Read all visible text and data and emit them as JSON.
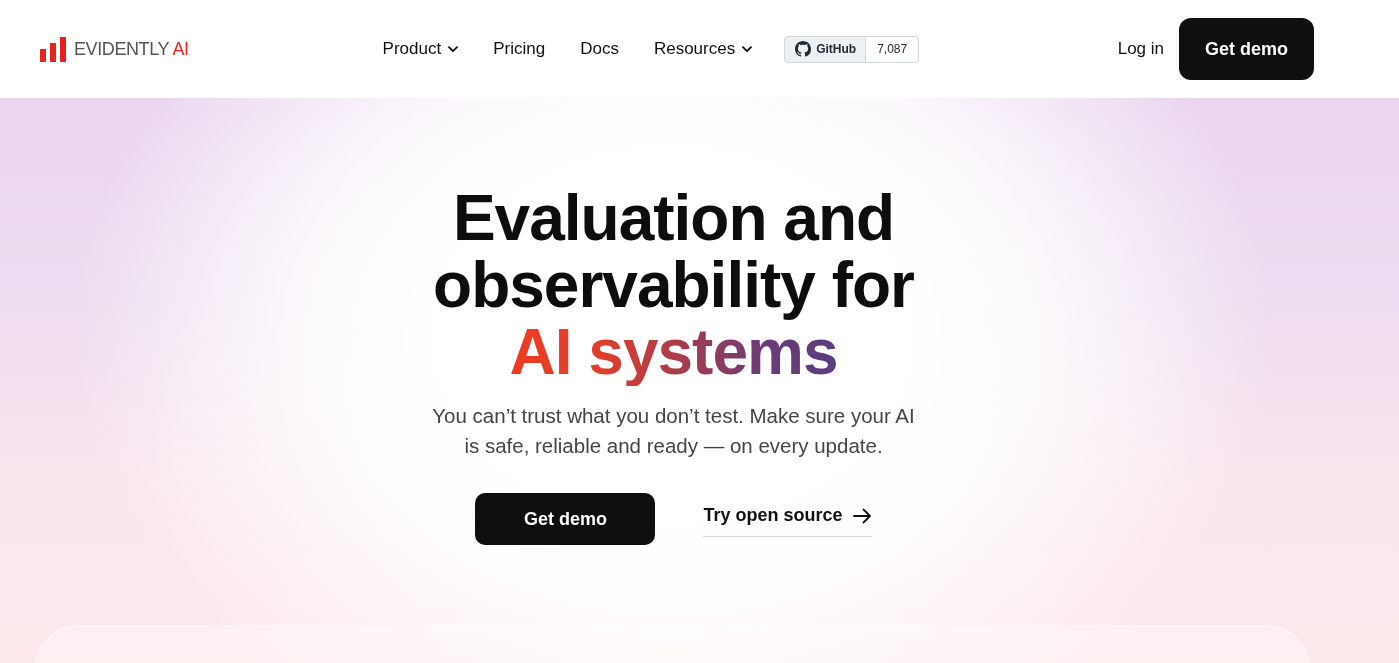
{
  "header": {
    "logo": {
      "name": "EVIDENTLY",
      "accent": "AI"
    },
    "nav": [
      {
        "label": "Product",
        "kind": "dropdown"
      },
      {
        "label": "Pricing",
        "kind": "link"
      },
      {
        "label": "Docs",
        "kind": "link"
      },
      {
        "label": "Resources",
        "kind": "dropdown"
      }
    ],
    "github": {
      "label": "GitHub",
      "count": "7,087"
    },
    "login": "Log in",
    "cta": "Get demo"
  },
  "hero": {
    "headline": "Evaluation and observability for",
    "highlight": "AI systems",
    "subtitle": "You can’t trust what you don’t test. Make sure your AI is safe, reliable and ready — on every update.",
    "primary_button": "Get demo",
    "secondary_link": "Try open source"
  }
}
